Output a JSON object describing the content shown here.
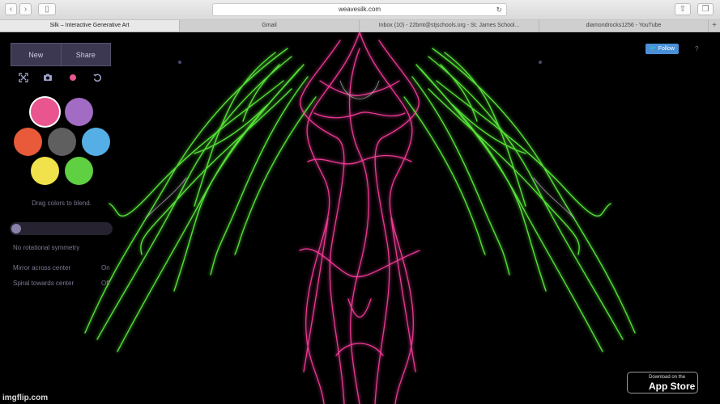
{
  "browser": {
    "url": "weavesilk.com",
    "tabs": [
      {
        "label": "Silk – Interactive Generative Art"
      },
      {
        "label": "Gmail"
      },
      {
        "label": "Inbox (10) - 22bmt@stjschools.org - St. James School..."
      },
      {
        "label": "diamondrocks1256 - YouTube"
      }
    ]
  },
  "panel": {
    "new_label": "New",
    "share_label": "Share",
    "blend_hint": "Drag colors to blend.",
    "symmetry_label": "No rotational symmetry",
    "mirror_label": "Mirror across center",
    "mirror_value": "On",
    "spiral_label": "Spiral towards center",
    "spiral_value": "Off",
    "colors": [
      "#e8558f",
      "#a26bc4",
      "#e85a3a",
      "#5f5f5f",
      "#55aee6",
      "#f1e14a",
      "#5fd041"
    ],
    "selected_color": "#e8558f"
  },
  "social": {
    "follow_label": "Follow",
    "help_label": "?"
  },
  "appstore": {
    "small_text": "Download on the",
    "big_text": "App Store"
  },
  "watermark": "imgflip.com"
}
